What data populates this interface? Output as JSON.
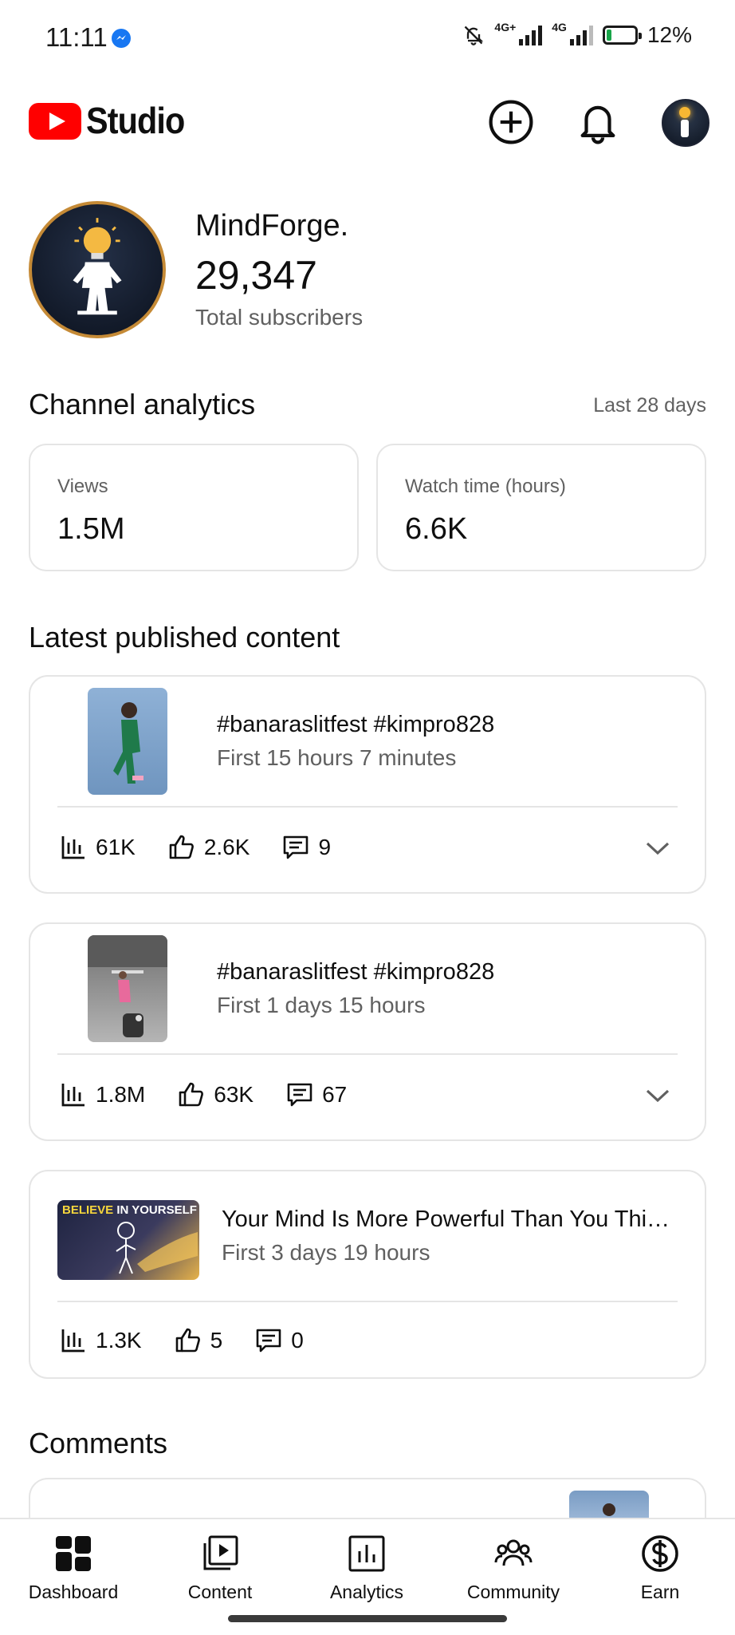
{
  "status_bar": {
    "time": "11:11",
    "network_1": "4G+",
    "network_2": "4G",
    "battery": "12%",
    "icons": [
      "messenger-icon",
      "bell-off-icon",
      "signal-icon",
      "battery-charging-icon"
    ]
  },
  "header": {
    "app_name": "Studio",
    "icons": [
      "create-icon",
      "notifications-icon",
      "account-avatar"
    ]
  },
  "channel": {
    "name": "MindForge.",
    "subscribers": "29,347",
    "subscribers_label": "Total subscribers"
  },
  "analytics": {
    "title": "Channel analytics",
    "range": "Last 28 days",
    "metrics": [
      {
        "label": "Views",
        "value": "1.5M"
      },
      {
        "label": "Watch time (hours)",
        "value": "6.6K"
      }
    ]
  },
  "latest": {
    "title": "Latest published content",
    "items": [
      {
        "title": "#banaraslitfest #kimpro828",
        "period": "First 15 hours 7 minutes",
        "views": "61K",
        "likes": "2.6K",
        "comments": "9"
      },
      {
        "title": "#banaraslitfest #kimpro828",
        "period": "First 1 days 15 hours",
        "views": "1.8M",
        "likes": "63K",
        "comments": "67"
      },
      {
        "title": "Your Mind Is More Powerful Than You Thi…",
        "period": "First 3 days 19 hours",
        "views": "1.3K",
        "likes": "5",
        "comments": "0",
        "thumb_text_1": "BELIEVE",
        "thumb_text_2": "IN YOURSELF"
      }
    ]
  },
  "comments": {
    "title": "Comments"
  },
  "nav": {
    "items": [
      {
        "label": "Dashboard",
        "icon": "dashboard-icon"
      },
      {
        "label": "Content",
        "icon": "content-icon"
      },
      {
        "label": "Analytics",
        "icon": "analytics-icon"
      },
      {
        "label": "Community",
        "icon": "community-icon"
      },
      {
        "label": "Earn",
        "icon": "earn-icon"
      }
    ]
  },
  "colors": {
    "brand_red": "#ff0000",
    "text": "#0f0f0f",
    "secondary": "#606060",
    "border": "#e5e5e5"
  }
}
